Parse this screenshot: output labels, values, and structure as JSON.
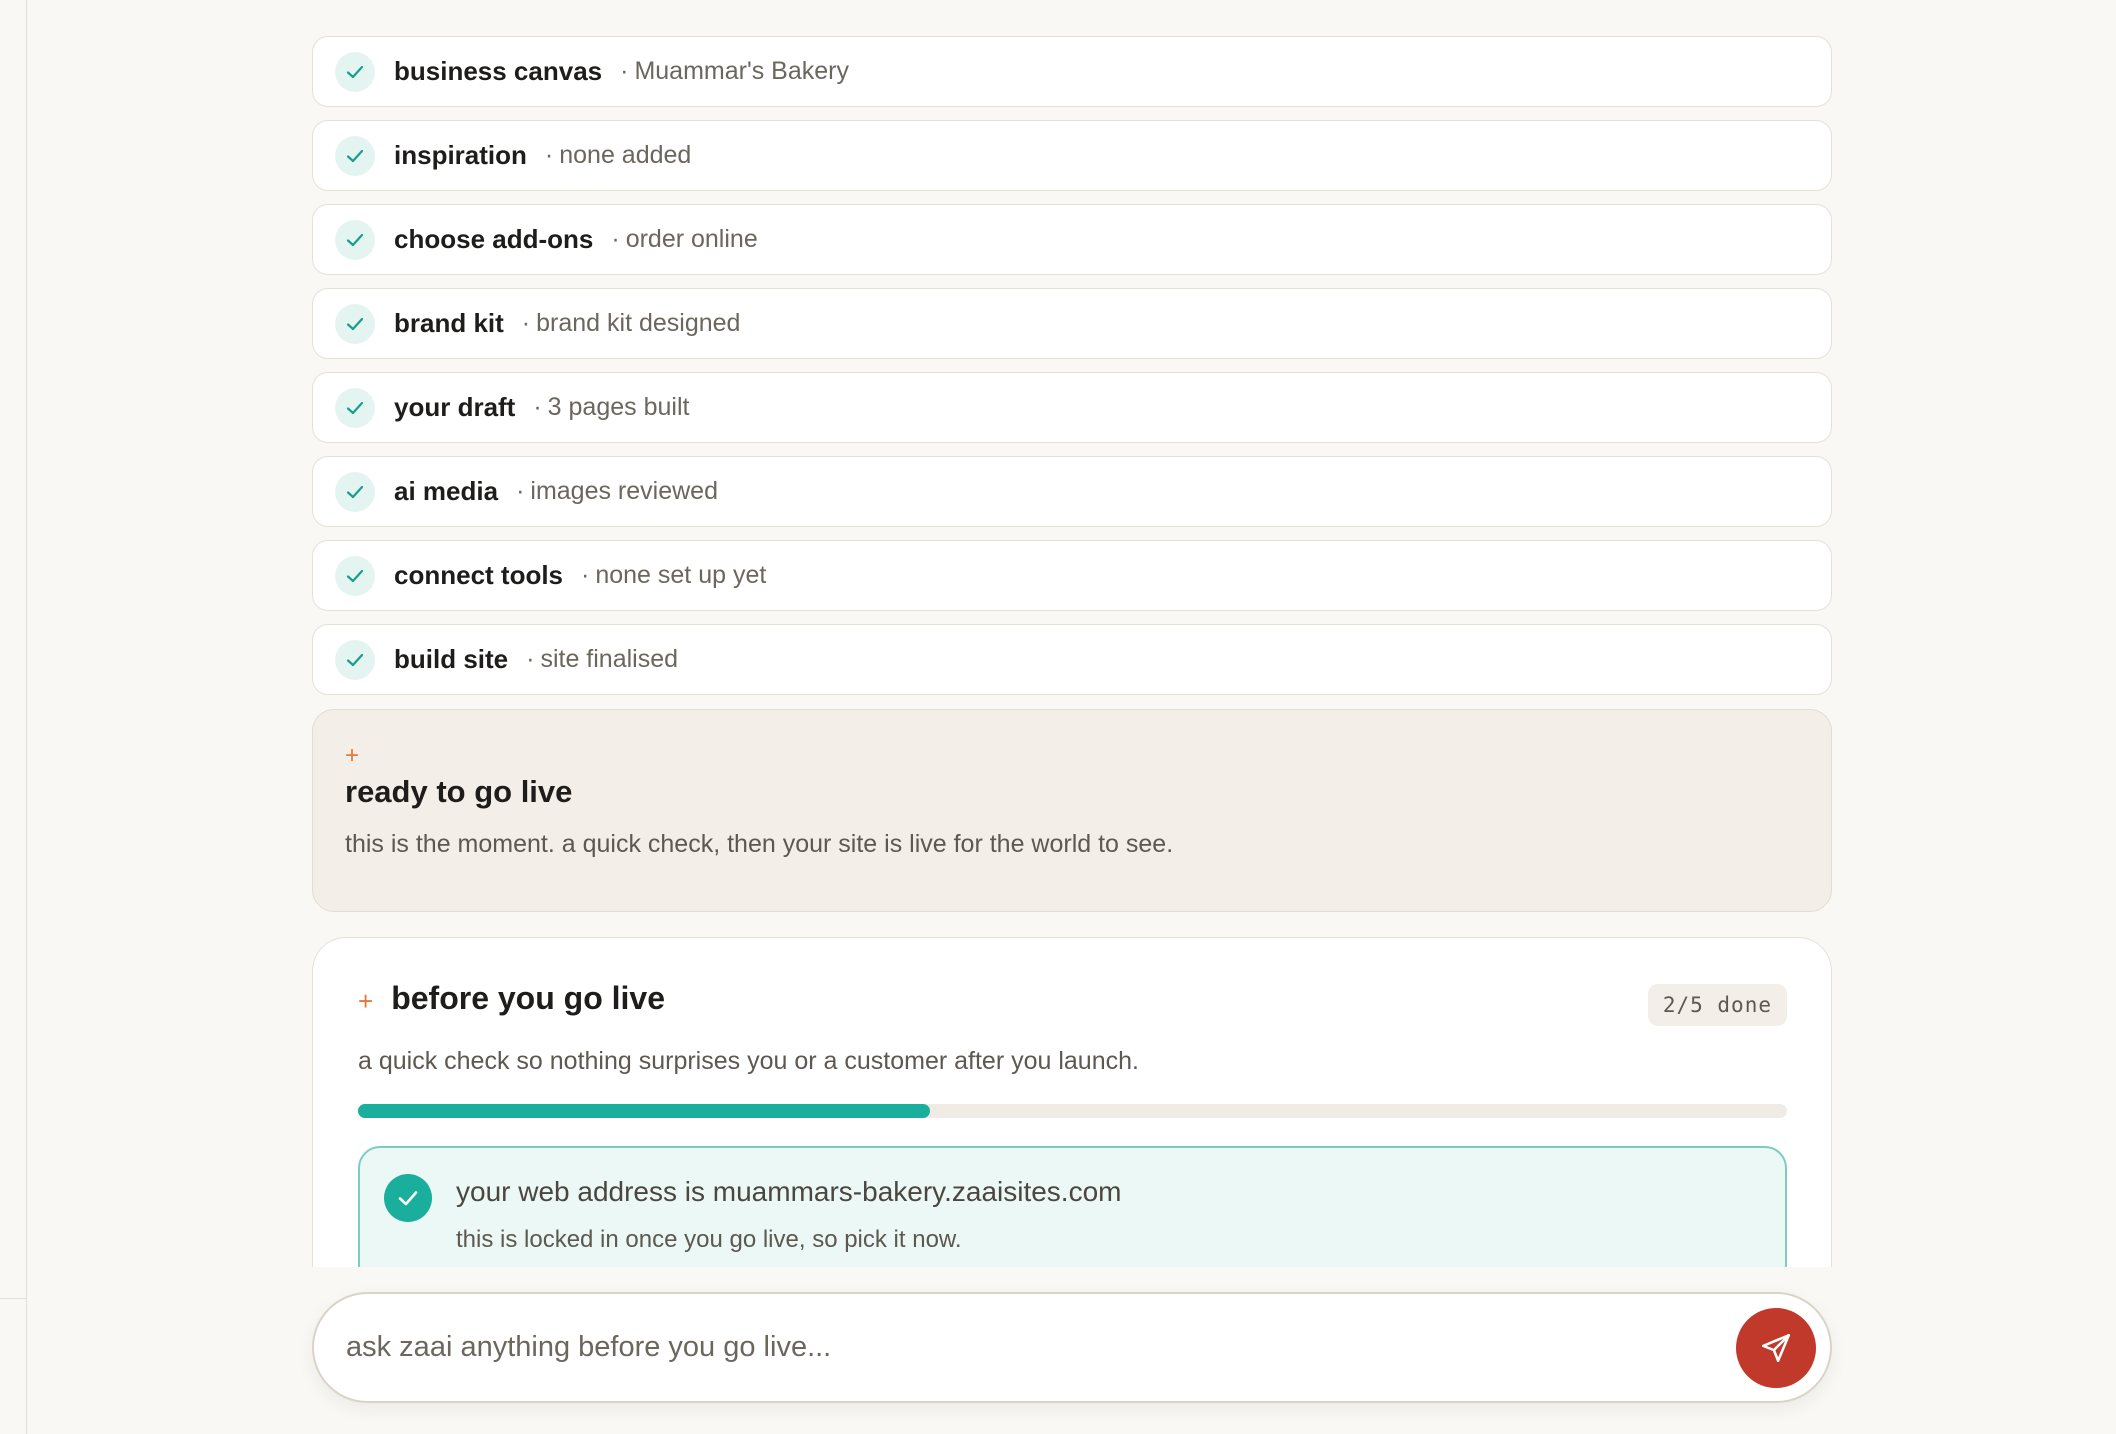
{
  "steps": [
    {
      "title": "business canvas",
      "sep": "·",
      "detail": "Muammar's Bakery"
    },
    {
      "title": "inspiration",
      "sep": "·",
      "detail": "none added"
    },
    {
      "title": "choose add-ons",
      "sep": "·",
      "detail": "order online"
    },
    {
      "title": "brand kit",
      "sep": "·",
      "detail": "brand kit designed"
    },
    {
      "title": "your draft",
      "sep": "·",
      "detail": "3 pages built"
    },
    {
      "title": "ai media",
      "sep": "·",
      "detail": "images reviewed"
    },
    {
      "title": "connect tools",
      "sep": "·",
      "detail": "none set up yet"
    },
    {
      "title": "build site",
      "sep": "·",
      "detail": "site finalised"
    }
  ],
  "ready": {
    "sparkle": "+",
    "title": "ready to go live",
    "subtitle": "this is the moment. a quick check, then your site is live for the world to see."
  },
  "checklist": {
    "sparkle": "+",
    "title": "before you go live",
    "badge": "2/5 done",
    "subtitle": "a quick check so nothing surprises you or a customer after you launch.",
    "progress_fraction": 0.4,
    "items": [
      {
        "title": "your web address is muammars-bakery.zaaisites.com",
        "detail": "this is locked in once you go live, so pick it now."
      }
    ]
  },
  "ask": {
    "placeholder": "ask zaai anything before you go live..."
  },
  "icons": {
    "step_check": "check-icon",
    "send": "send-icon"
  },
  "colors": {
    "accent_teal": "#1aaf9c",
    "accent_orange": "#e07a3c",
    "send_red": "#c0392b"
  }
}
